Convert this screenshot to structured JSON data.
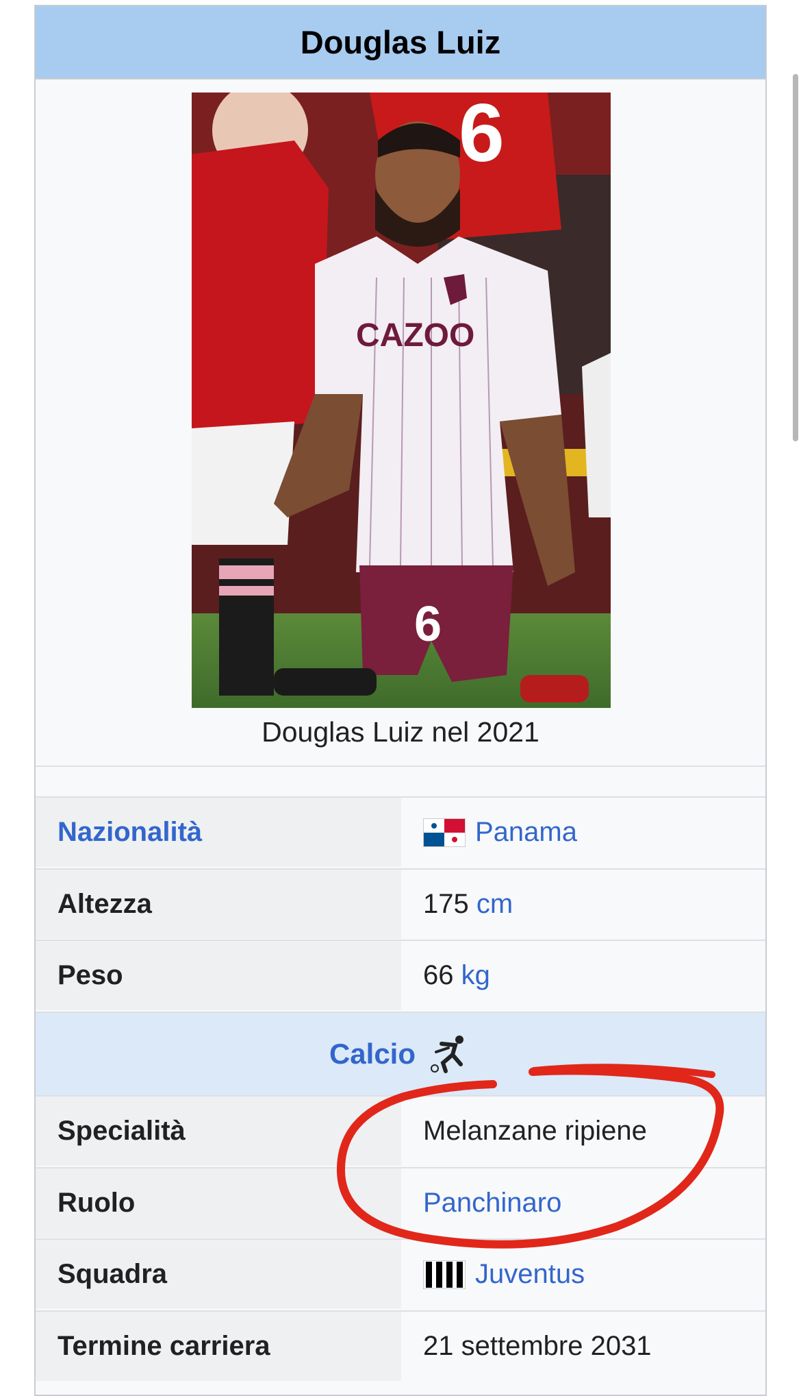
{
  "infobox": {
    "title": "Douglas Luiz",
    "caption": "Douglas Luiz nel 2021",
    "rows": [
      {
        "label": "Nazionalità",
        "value": "Panama"
      },
      {
        "label": "Altezza",
        "value": "175",
        "unit": "cm"
      },
      {
        "label": "Peso",
        "value": "66",
        "unit": "kg"
      }
    ],
    "section_header": "Calcio",
    "section_rows": [
      {
        "label": "Specialità",
        "value": "Melanzane ripiene"
      },
      {
        "label": "Ruolo",
        "value": "Panchinaro"
      },
      {
        "label": "Squadra",
        "value": "Juventus"
      },
      {
        "label": "Termine carriera",
        "value": "21 settembre 2031"
      }
    ]
  },
  "colors": {
    "title_bg": "#a8cbf0",
    "link": "#3366cc",
    "section_bg": "#dbe9f8",
    "annotation": "#e0271a"
  },
  "icons": [
    "panama-flag-icon",
    "juventus-stripes-icon",
    "football-player-icon"
  ]
}
